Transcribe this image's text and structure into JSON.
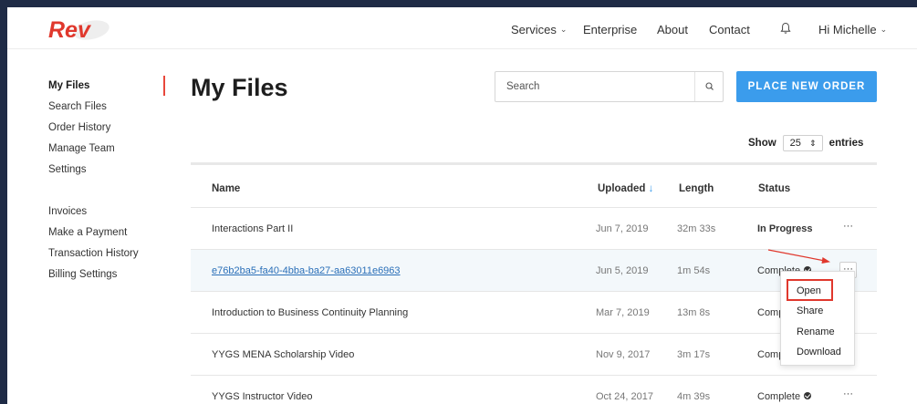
{
  "header": {
    "logo_text": "Rev",
    "nav": {
      "services": "Services",
      "enterprise": "Enterprise",
      "about": "About",
      "contact": "Contact",
      "user": "Hi Michelle"
    }
  },
  "sidebar": {
    "group1": [
      "My Files",
      "Search Files",
      "Order History",
      "Manage Team",
      "Settings"
    ],
    "group2": [
      "Invoices",
      "Make a Payment",
      "Transaction History",
      "Billing Settings"
    ]
  },
  "main": {
    "title": "My Files",
    "search_placeholder": "Search",
    "order_button": "PLACE NEW ORDER",
    "entries": {
      "show": "Show",
      "value": "25",
      "suffix": "entries"
    }
  },
  "table": {
    "headers": {
      "name": "Name",
      "uploaded": "Uploaded",
      "sort_arrow": "↓",
      "length": "Length",
      "status": "Status"
    },
    "rows": [
      {
        "name": "Interactions Part II",
        "uploaded": "Jun 7, 2019",
        "length": "32m 33s",
        "status": "In Progress",
        "more": "···"
      },
      {
        "name": "e76b2ba5-fa40-4bba-ba27-aa63011e6963",
        "uploaded": "Jun 5, 2019",
        "length": "1m 54s",
        "status": "Complete",
        "more": "···"
      },
      {
        "name": "Introduction to Business Continuity Planning",
        "uploaded": "Mar 7, 2019",
        "length": "13m 8s",
        "status": "Comp",
        "more": ""
      },
      {
        "name": "YYGS MENA Scholarship Video",
        "uploaded": "Nov 9, 2017",
        "length": "3m 17s",
        "status": "Comp",
        "more": ""
      },
      {
        "name": "YYGS Instructor Video",
        "uploaded": "Oct 24, 2017",
        "length": "4m 39s",
        "status": "Complete",
        "more": "···"
      }
    ]
  },
  "menu": {
    "items": [
      "Open",
      "Share",
      "Rename",
      "Download"
    ]
  },
  "colors": {
    "accent": "#3b9cec",
    "brand_red": "#e0382d",
    "frame_bg": "#1f2b46"
  }
}
